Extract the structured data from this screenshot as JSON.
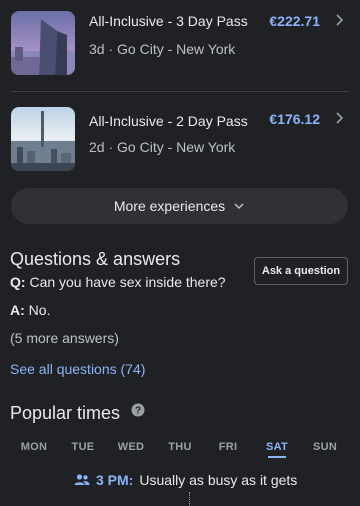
{
  "experiences": [
    {
      "title": "All-Inclusive - 3 Day Pass",
      "duration": "3d",
      "separator": " · ",
      "provider": "Go City - New York",
      "price": "€222.71"
    },
    {
      "title": "All-Inclusive - 2 Day Pass",
      "duration": "2d",
      "separator": " · ",
      "provider": "Go City - New York",
      "price": "€176.12"
    }
  ],
  "more_experiences_label": "More experiences",
  "qa": {
    "title": "Questions & answers",
    "ask_label": "Ask a question",
    "q_prefix": "Q:",
    "question": "Can you have sex inside there?",
    "a_prefix": "A:",
    "answer": "No.",
    "more_answers": "(5 more answers)",
    "see_all": "See all questions (74)"
  },
  "popular": {
    "title": "Popular times",
    "days": [
      "MON",
      "TUE",
      "WED",
      "THU",
      "FRI",
      "SAT",
      "SUN"
    ],
    "selected_day": "SAT",
    "time": "3 PM:",
    "status": "Usually as busy as it gets"
  },
  "colors": {
    "background": "#202124",
    "accent": "#8ab4f8",
    "button_bg": "#303134"
  },
  "icons": {
    "chevron_right": "chevron-right-icon",
    "chevron_down": "chevron-down-icon",
    "help": "help-circle-icon",
    "people": "people-icon"
  }
}
